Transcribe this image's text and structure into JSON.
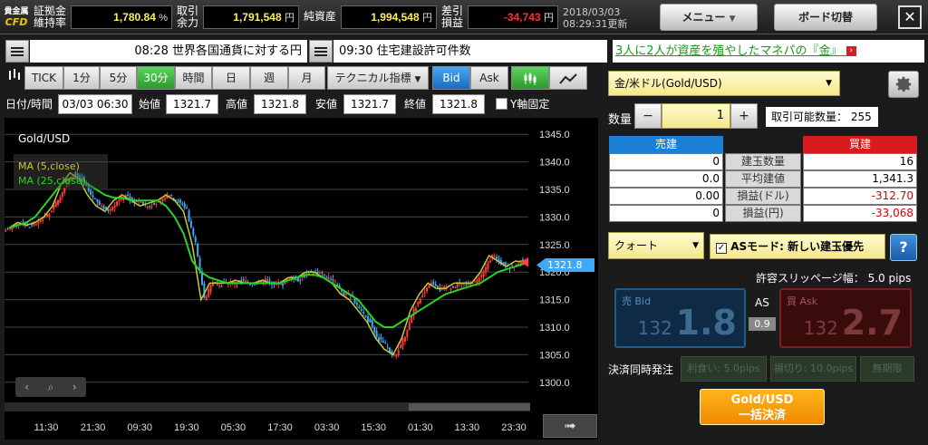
{
  "topbar": {
    "logo_top": "貴金属",
    "logo_bottom": "CFD",
    "margin_label1": "証拠金",
    "margin_label2": "維持率",
    "margin_value": "1,780.84",
    "margin_unit": "%",
    "avail_label1": "取引",
    "avail_label2": "余力",
    "avail_value": "1,791,548",
    "yen": "円",
    "net_label": "純資産",
    "net_value": "1,994,548",
    "pl_label1": "差引",
    "pl_label2": "損益",
    "pl_value": "-34,743",
    "date": "2018/03/03",
    "update": "08:29:31更新",
    "menu_button": "メニュー",
    "board_button": "ボード切替",
    "close_symbol": "✕"
  },
  "news": {
    "item1": "08:28 世界各国通貨に対する円",
    "item2": "09:30 住宅建設許可件数",
    "ad": "3人に2人が資産を殖やしたマネパの『金』"
  },
  "toolbar": {
    "tick": "TICK",
    "m1": "1分",
    "m5": "5分",
    "m30": "30分",
    "hour": "時間",
    "day": "日",
    "week": "週",
    "month": "月",
    "tech": "テクニカル指標",
    "bid": "Bid",
    "ask": "Ask"
  },
  "ohlc": {
    "datetime_label": "日付/時間",
    "datetime": "03/03 06:30",
    "open_label": "始値",
    "open": "1321.7",
    "high_label": "高値",
    "high": "1321.8",
    "low_label": "安値",
    "low": "1321.7",
    "close_label": "終値",
    "close": "1321.8",
    "yfix_label": "Y軸固定"
  },
  "chart_data": {
    "type": "candlestick",
    "title": "Gold/USD",
    "legend": [
      "MA (5,close)",
      "MA (25,close)"
    ],
    "colors": {
      "up": "#ff3b3b",
      "down": "#3fa9f5",
      "ma5": "#c9c93a",
      "ma25": "#28d228"
    },
    "ylim": [
      1297,
      1348
    ],
    "y_ticks": [
      "1345.0",
      "1340.0",
      "1335.0",
      "1330.0",
      "1325.0",
      "1320.0",
      "1315.0",
      "1310.0",
      "1305.0",
      "1300.0"
    ],
    "x_ticks": [
      "11:30",
      "21:30",
      "09:30",
      "19:30",
      "05:30",
      "17:30",
      "03:30",
      "15:30",
      "01:30",
      "13:30",
      "23:30"
    ],
    "current_price": "1321.8",
    "close_path": [
      1328,
      1329,
      1328.5,
      1329,
      1330,
      1332,
      1336,
      1338,
      1337,
      1334,
      1332,
      1331,
      1333,
      1334,
      1333,
      1332,
      1332.5,
      1333,
      1334,
      1333,
      1331,
      1325,
      1315,
      1318,
      1318,
      1318,
      1318.5,
      1318,
      1318,
      1318.5,
      1318,
      1318,
      1319,
      1319,
      1320,
      1320,
      1319,
      1318,
      1316,
      1315,
      1313,
      1311,
      1308,
      1306,
      1305,
      1308,
      1313,
      1316,
      1318,
      1317,
      1317,
      1318,
      1318,
      1318,
      1320,
      1323,
      1322,
      1321,
      1322,
      1321.8
    ],
    "ma25_path": [
      1328,
      1328.5,
      1329,
      1330,
      1332,
      1334,
      1336,
      1337,
      1337,
      1336,
      1335,
      1334,
      1333.5,
      1333.5,
      1333,
      1333,
      1333,
      1333,
      1332,
      1330,
      1327,
      1322,
      1320,
      1319,
      1318.5,
      1318,
      1318,
      1318,
      1318,
      1318,
      1318,
      1318,
      1318.5,
      1319,
      1319.5,
      1319.5,
      1319,
      1318,
      1317,
      1316,
      1315,
      1313,
      1311,
      1310,
      1310,
      1311,
      1312,
      1313,
      1314,
      1315,
      1316,
      1316.5,
      1317,
      1317.5,
      1318,
      1319,
      1320,
      1320.5,
      1321,
      1321.5
    ]
  },
  "panel": {
    "instrument": "金/米ドル(Gold/USD)",
    "qty_label": "数量",
    "minus": "−",
    "qty": "1",
    "plus": "+",
    "avail_qty": "取引可能数量： 255",
    "sell_header": "売建",
    "buy_header": "買建",
    "rows": [
      {
        "sell": "0",
        "label": "建玉数量",
        "buy": "16"
      },
      {
        "sell": "0.0",
        "label": "平均建値",
        "buy": "1,341.3"
      },
      {
        "sell": "0.00",
        "label": "損益(ドル)",
        "buy": "-312.70"
      },
      {
        "sell": "0",
        "label": "損益(円)",
        "buy": "-33,068"
      }
    ],
    "order_type": "クォート",
    "as_mode": "ASモード: 新しい建玉優先",
    "help": "?",
    "slippage": "許容スリッページ幅： 5.0 pips",
    "bid_label": "売 Bid",
    "bid_small": "132",
    "bid_big": "1.8",
    "ask_label": "買 Ask",
    "ask_small": "132",
    "ask_big": "2.7",
    "as_label": "AS",
    "spread": "0.9",
    "settle_label": "決済同時発注",
    "take_profit": "利食い: 5.0pips",
    "stop_loss": "損切り: 10.0pips",
    "unlimited": "無期限",
    "settle_btn1": "Gold/USD",
    "settle_btn2": "一括決済"
  }
}
